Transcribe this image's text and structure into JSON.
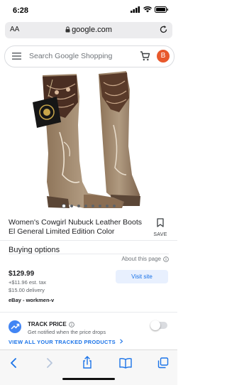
{
  "status_bar": {
    "time": "6:28"
  },
  "browser": {
    "aa_label": "AA",
    "url": "google.com"
  },
  "search": {
    "placeholder": "Search Google Shopping",
    "avatar_letter": "B"
  },
  "product": {
    "image_count": 8,
    "active_image_index": 0,
    "title": "Women's Cowgirl Nubuck Leather Boots El General Limited Edition Color",
    "save_label": "SAVE"
  },
  "buying_options": {
    "heading": "Buying options",
    "about_label": "About this page",
    "offer": {
      "price": "$129.99",
      "tax": "+$11.96 est. tax",
      "delivery": "$15.00 delivery",
      "seller": "eBay - workmen-v",
      "visit_label": "Visit site"
    }
  },
  "track_price": {
    "title": "TRACK PRICE",
    "subtitle": "Get notified when the price drops",
    "enabled": false,
    "view_all_label": "VIEW ALL YOUR TRACKED PRODUCTS"
  },
  "colors": {
    "link_blue": "#1a73e8",
    "avatar_orange": "#e8592c",
    "boot_leather": "#a48b70"
  },
  "toolbar": {
    "icons": [
      "back-icon",
      "forward-icon",
      "share-icon",
      "bookmarks-icon",
      "tabs-icon"
    ]
  }
}
